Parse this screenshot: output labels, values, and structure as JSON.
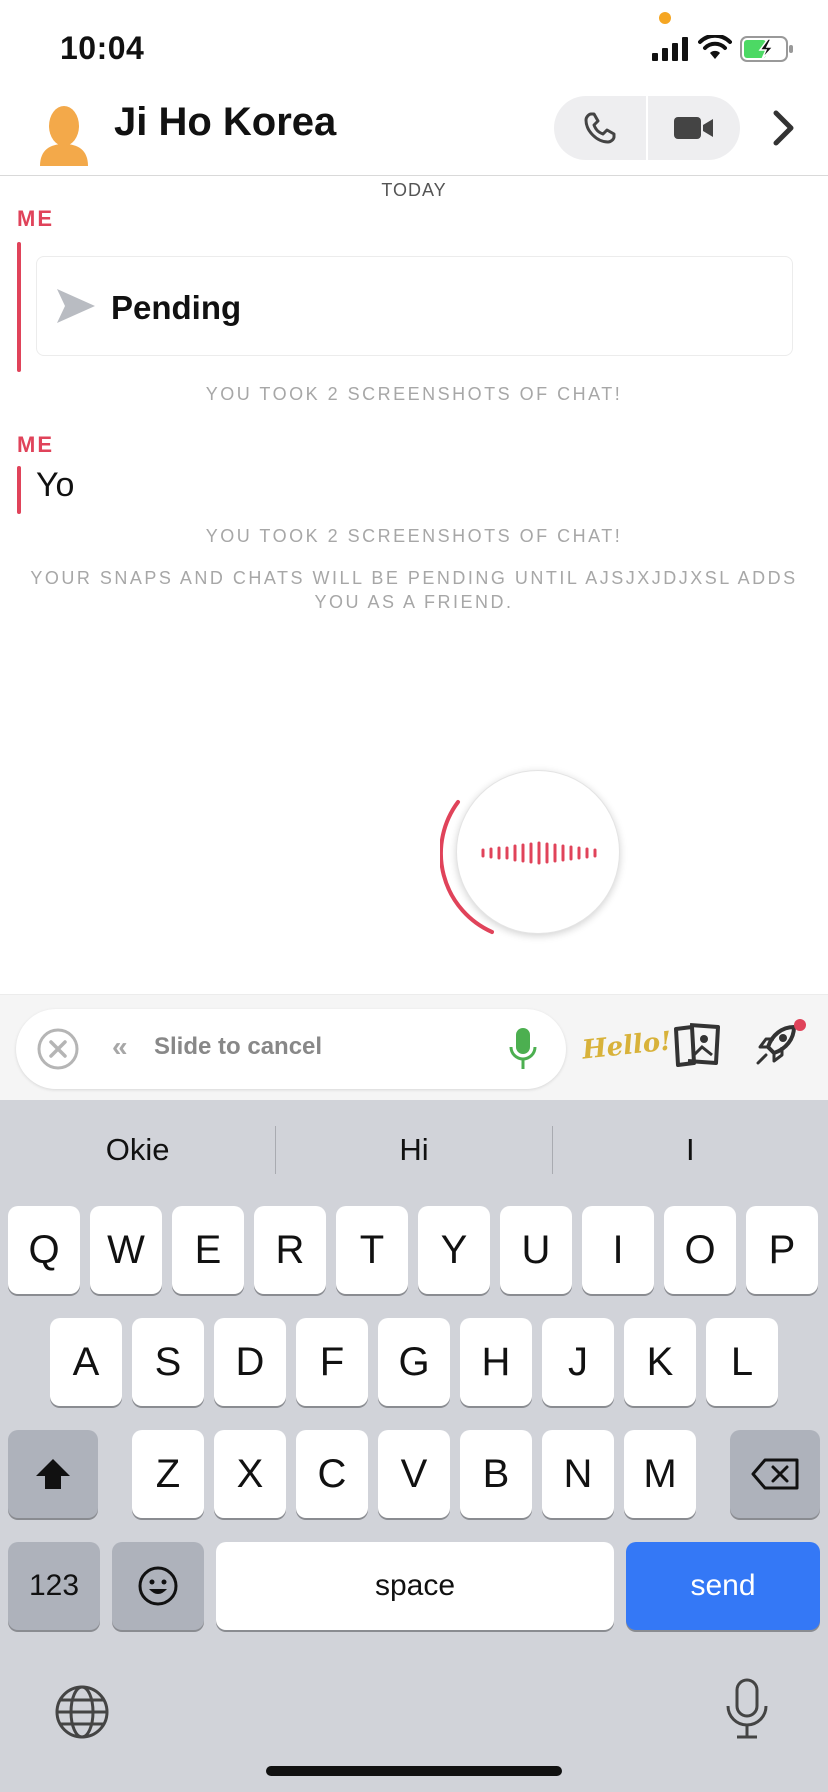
{
  "status_bar": {
    "time": "10:04"
  },
  "header": {
    "contact_name": "Ji Ho Korea",
    "icons": [
      "avatar-icon",
      "phone-icon",
      "video-camera-icon",
      "chevron-right-icon"
    ]
  },
  "chat": {
    "date": "TODAY",
    "messages": [
      {
        "sender": "ME",
        "type": "snap",
        "text": "Pending"
      },
      {
        "sender": "ME",
        "type": "text",
        "text": "Yo"
      }
    ],
    "notes": {
      "screenshot_1": "YOU TOOK 2 SCREENSHOTS OF CHAT!",
      "screenshot_2": "YOU TOOK 2 SCREENSHOTS OF CHAT!",
      "pending_friend": "YOUR SNAPS AND CHATS WILL BE PENDING UNTIL AJSJXJDJXSL ADDS YOU AS A FRIEND."
    }
  },
  "input_bar": {
    "slide_arrows": "«",
    "slide_text": "Slide to cancel",
    "sticker_text": "Hello!"
  },
  "keyboard": {
    "suggestions": [
      "Okie",
      "Hi",
      "I"
    ],
    "row1": [
      "Q",
      "W",
      "E",
      "R",
      "T",
      "Y",
      "U",
      "I",
      "O",
      "P"
    ],
    "row2": [
      "A",
      "S",
      "D",
      "F",
      "G",
      "H",
      "J",
      "K",
      "L"
    ],
    "row3": [
      "Z",
      "X",
      "C",
      "V",
      "B",
      "N",
      "M"
    ],
    "numbers_label": "123",
    "space_label": "space",
    "send_label": "send"
  },
  "colors": {
    "accent_red": "#e0435a",
    "send_blue": "#3478f6",
    "mic_green": "#4caf50"
  }
}
